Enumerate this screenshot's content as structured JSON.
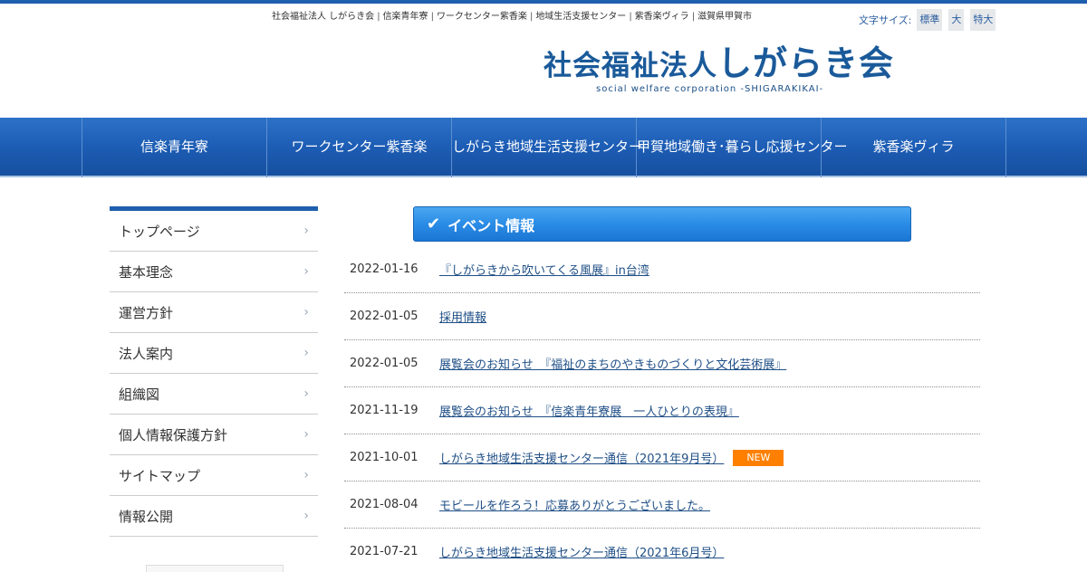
{
  "header": {
    "top_links": [
      "社会福祉法人 しがらき会",
      "信楽青年寮",
      "ワークセンター紫香楽",
      "地域生活支援センター",
      "紫香楽ヴィラ",
      "滋賀県甲賀市"
    ],
    "font_size_label": "文字サイズ:",
    "font_size_options": [
      "標準",
      "大",
      "特大"
    ],
    "logo_prefix": "社会福祉法人",
    "logo_name": "しがらき会",
    "logo_english": "social welfare corporation -SHIGARAKIKAI-"
  },
  "global_nav": [
    "信楽青年寮",
    "ワークセンター紫香楽",
    "しがらき地域生活支援センター",
    "甲賀地域働き･暮らし応援センター",
    "紫香楽ヴィラ"
  ],
  "sidebar": {
    "items": [
      "トップページ",
      "基本理念",
      "運営方針",
      "法人案内",
      "組織図",
      "個人情報保護方針",
      "サイトマップ",
      "情報公開"
    ]
  },
  "events": {
    "heading": "イベント情報",
    "new_badge": "NEW",
    "items": [
      {
        "date": "2022-01-16",
        "title": "『しがらきから吹いてくる風展』in台湾",
        "is_new": false
      },
      {
        "date": "2022-01-05",
        "title": "採用情報",
        "is_new": false
      },
      {
        "date": "2022-01-05",
        "title": "展覧会のお知らせ　『福祉のまちのやきものづくりと文化芸術展』",
        "is_new": false
      },
      {
        "date": "2021-11-19",
        "title": "展覧会のお知らせ　『信楽青年寮展　一人ひとりの表現』",
        "is_new": false
      },
      {
        "date": "2021-10-01",
        "title": "しがらき地域生活支援センター通信（2021年9月号）",
        "is_new": true
      },
      {
        "date": "2021-08-04",
        "title": "モビールを作ろう！応募ありがとうございました。",
        "is_new": false
      },
      {
        "date": "2021-07-21",
        "title": "しがらき地域生活支援センター通信（2021年6月号）",
        "is_new": false
      }
    ]
  },
  "colors": {
    "brand_blue": "#1f5fae",
    "new_badge": "#ff8000"
  }
}
